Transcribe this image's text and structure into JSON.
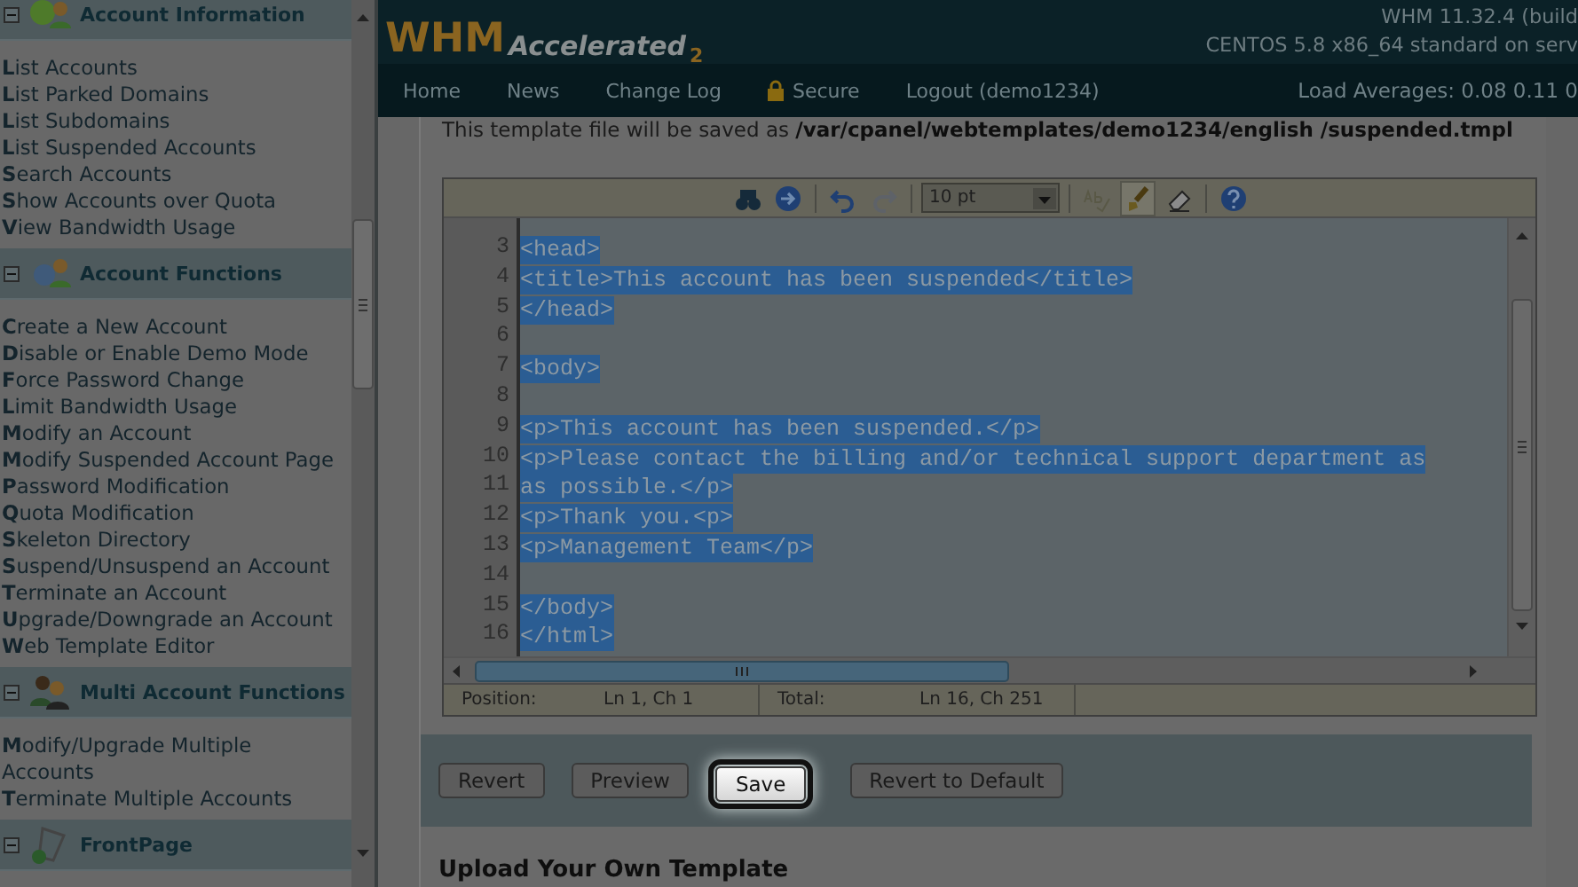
{
  "sidebar": {
    "sections": [
      {
        "title": "Account Information",
        "expanded": true,
        "items": [
          "**L**ist Accounts",
          "**L**ist Parked Domains",
          "**L**ist Subdomains",
          "**L**ist Suspended Accounts",
          "**S**earch Accounts",
          "**S**how Accounts over Quota",
          "**V**iew Bandwidth Usage"
        ]
      },
      {
        "title": "Account Functions",
        "expanded": true,
        "items": [
          "**C**reate a New Account",
          "**D**isable or Enable Demo Mode",
          "**F**orce Password Change",
          "**L**imit Bandwidth Usage",
          "**M**odify an Account",
          "**M**odify Suspended Account Page",
          "**P**assword Modification",
          "**Q**uota Modification",
          "**S**keleton Directory",
          "**S**uspend/Unsuspend an Account",
          "**T**erminate an Account",
          "**U**pgrade/Downgrade an Account",
          "**W**eb Template Editor"
        ]
      },
      {
        "title": "Multi Account Functions",
        "expanded": true,
        "items": [
          "**M**odify/Upgrade Multiple Accounts",
          "**T**erminate Multiple Accounts"
        ]
      },
      {
        "title": "FrontPage",
        "expanded": true
      }
    ]
  },
  "header": {
    "logo": "WHM",
    "logo_sub": "Accelerated",
    "logo_version": "2",
    "build": "WHM 11.32.4 (build",
    "os": "CENTOS 5.8 x86_64 standard on serv"
  },
  "nav": {
    "items": [
      {
        "label": "Home",
        "kind": "link"
      },
      {
        "label": "News",
        "kind": "link"
      },
      {
        "label": "Change Log",
        "kind": "link"
      },
      {
        "label": "Secure",
        "kind": "lock"
      },
      {
        "label": "Logout (demo1234)",
        "kind": "link"
      }
    ],
    "load": "Load Averages: 0.08 0.11 0"
  },
  "template_note": "This template file will be saved as **/var/cpanel/webtemplates/demo1234/english /suspended.tmpl**",
  "editor": {
    "toolbar": [
      {
        "kind": "find",
        "disabled": false
      },
      {
        "kind": "goto",
        "disabled": false
      },
      {
        "kind": "sep"
      },
      {
        "kind": "undo",
        "disabled": false
      },
      {
        "kind": "redo",
        "disabled": true
      },
      {
        "kind": "sep"
      },
      {
        "kind": "size",
        "value": "10 pt"
      },
      {
        "kind": "sep"
      },
      {
        "kind": "spell",
        "disabled": true
      },
      {
        "kind": "brush",
        "disabled": false,
        "selected": true
      },
      {
        "kind": "eraser",
        "disabled": false
      },
      {
        "kind": "sep"
      },
      {
        "kind": "help",
        "disabled": false
      }
    ],
    "lines": [
      {
        "number": "3",
        "text": "<head>",
        "selected": true
      },
      {
        "number": "4",
        "text": "<title>This account has been suspended</title>",
        "selected": true
      },
      {
        "number": "5",
        "text": "</head>",
        "selected": true
      },
      {
        "number": "6"
      },
      {
        "number": "7",
        "text": "<body>",
        "selected": true
      },
      {
        "number": "8"
      },
      {
        "number": "9",
        "text": "<p>This account has been suspended.</p>",
        "selected": true
      },
      {
        "number": "10",
        "text": "<p>Please contact the billing and/or technical support department as",
        "selected": true
      },
      {
        "number": "11",
        "text": "as possible.</p>",
        "selected": true
      },
      {
        "number": "12",
        "text": "<p>Thank you.<p>",
        "selected": true
      },
      {
        "number": "13",
        "text": "<p>Management Team</p>",
        "selected": true
      },
      {
        "number": "14"
      },
      {
        "number": "15",
        "text": "</body>",
        "selected": true
      },
      {
        "number": "16",
        "text": "</html>",
        "selected": true
      }
    ],
    "status": [
      {
        "label": "Position:",
        "value": "Ln 1, Ch 1"
      },
      {
        "label": "Total:",
        "value": "Ln 16, Ch 251"
      }
    ]
  },
  "buttons": [
    {
      "label": "Revert",
      "highlighted": false
    },
    {
      "label": "Preview",
      "highlighted": false
    },
    {
      "label": "Save",
      "highlighted": true
    },
    {
      "label": "Revert to Default",
      "highlighted": false
    }
  ],
  "upload_heading": "Upload Your Own Template"
}
